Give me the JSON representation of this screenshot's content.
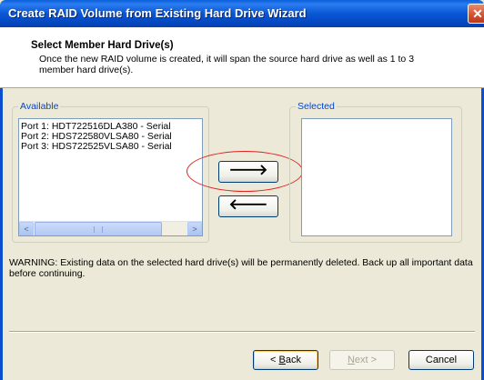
{
  "window": {
    "title": "Create RAID Volume from Existing Hard Drive Wizard",
    "close_glyph": "✕"
  },
  "header": {
    "title": "Select Member Hard Drive(s)",
    "description": "Once the new RAID volume is created, it will span the source hard drive as well as 1 to 3 member hard drive(s)."
  },
  "available": {
    "label": "Available",
    "items": [
      "Port 1: HDT722516DLA380 - Serial",
      "Port 2: HDS722580VLSA80 - Serial",
      "Port 3: HDS722525VLSA80 - Serial"
    ],
    "scroll_left": "<",
    "scroll_right": ">"
  },
  "selected": {
    "label": "Selected",
    "items": []
  },
  "transfer": {
    "add_glyph": "🡒",
    "remove_glyph": "🡐"
  },
  "warning": "WARNING: Existing data on the selected hard drive(s) will be permanently deleted. Back up all important data before continuing.",
  "buttons": {
    "back_prefix": "< ",
    "back_key": "B",
    "back_rest": "ack",
    "next_prefix": "",
    "next_key": "N",
    "next_rest": "ext >",
    "cancel": "Cancel"
  },
  "colors": {
    "titlebar": "#0957d6",
    "group_label": "#0046d5",
    "highlight": "#e02020"
  }
}
